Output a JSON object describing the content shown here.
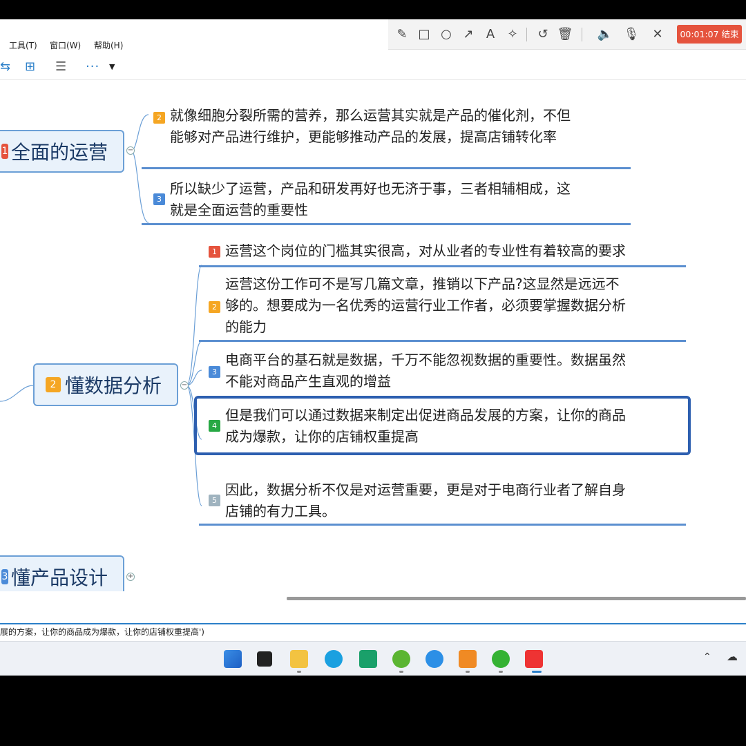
{
  "menu": {
    "tools": "工具(T)",
    "window": "窗口(W)",
    "help": "帮助(H)"
  },
  "recorder": {
    "timer": "00:01:07 结束"
  },
  "colors": {
    "accent": "#2b7fc9",
    "badge_red": "#e5533d",
    "badge_orange": "#f5a623",
    "badge_blue": "#4a8ad8",
    "badge_green": "#27a844",
    "badge_gray": "#9fb3bf"
  },
  "topics": [
    {
      "num": "1",
      "label": "全面的运营"
    },
    {
      "num": "2",
      "label": "懂数据分析"
    },
    {
      "num": "3",
      "label": "懂产品设计"
    }
  ],
  "topic1_subs": [
    {
      "badge": "2",
      "text_line1": "就像细胞分裂所需的营养，那么运营其实就是产品的催化剂，不但",
      "text_line2": "能够对产品进行维护，更能够推动产品的发展，提高店铺转化率"
    },
    {
      "badge": "3",
      "text_line1": "所以缺少了运营，产品和研发再好也无济于事，三者相辅相成，这",
      "text_line2": "就是全面运营的重要性"
    }
  ],
  "topic2_subs": [
    {
      "badge": "1",
      "text_line1": "运营这个岗位的门槛其实很高，对从业者的专业性有着较高的要求"
    },
    {
      "badge": "2",
      "text_line1": "运营这份工作可不是写几篇文章，推销以下产品?这显然是远远不",
      "text_line2": "够的。想要成为一名优秀的运营行业工作者，必须要掌握数据分析",
      "text_line3": "的能力"
    },
    {
      "badge": "3",
      "text_line1": "电商平台的基石就是数据，千万不能忽视数据的重要性。数据虽然",
      "text_line2": "不能对商品产生直观的增益"
    },
    {
      "badge": "4",
      "text_line1": "但是我们可以通过数据来制定出促进商品发展的方案，让你的商品",
      "text_line2": "成为爆款，让你的店铺权重提高"
    },
    {
      "badge": "5",
      "text_line1": "因此，数据分析不仅是对运营重要，更是对于电商行业者了解自身",
      "text_line2": "店铺的有力工具。"
    }
  ],
  "statusbar": {
    "text": "展的方案，让你的商品成为爆款，让你的店铺权重提高')"
  }
}
